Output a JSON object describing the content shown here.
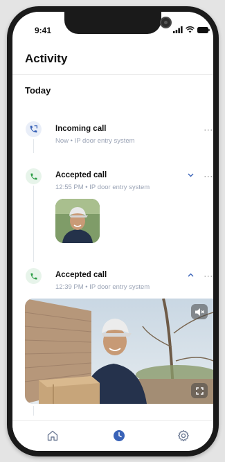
{
  "status_bar": {
    "time": "9:41"
  },
  "header": {
    "title": "Activity"
  },
  "section": {
    "label": "Today"
  },
  "activity": [
    {
      "title": "Incoming call",
      "subtitle": "Now • IP door entry system",
      "icon": "phone-incoming-icon",
      "expanded": null
    },
    {
      "title": "Accepted call",
      "subtitle": "12:55 PM • IP door entry system",
      "icon": "phone-icon",
      "expanded": false
    },
    {
      "title": "Accepted call",
      "subtitle": "12:39 PM • IP door entry system",
      "icon": "phone-icon",
      "expanded": true
    }
  ],
  "more_label": "···",
  "tabs": [
    {
      "name": "home",
      "icon": "home-icon",
      "active": false
    },
    {
      "name": "activity",
      "icon": "clock-icon",
      "active": true
    },
    {
      "name": "settings",
      "icon": "gear-icon",
      "active": false
    }
  ],
  "colors": {
    "accent_blue": "#3a63b8",
    "accent_green": "#2f9e48",
    "muted_text": "#9aa3b5"
  }
}
